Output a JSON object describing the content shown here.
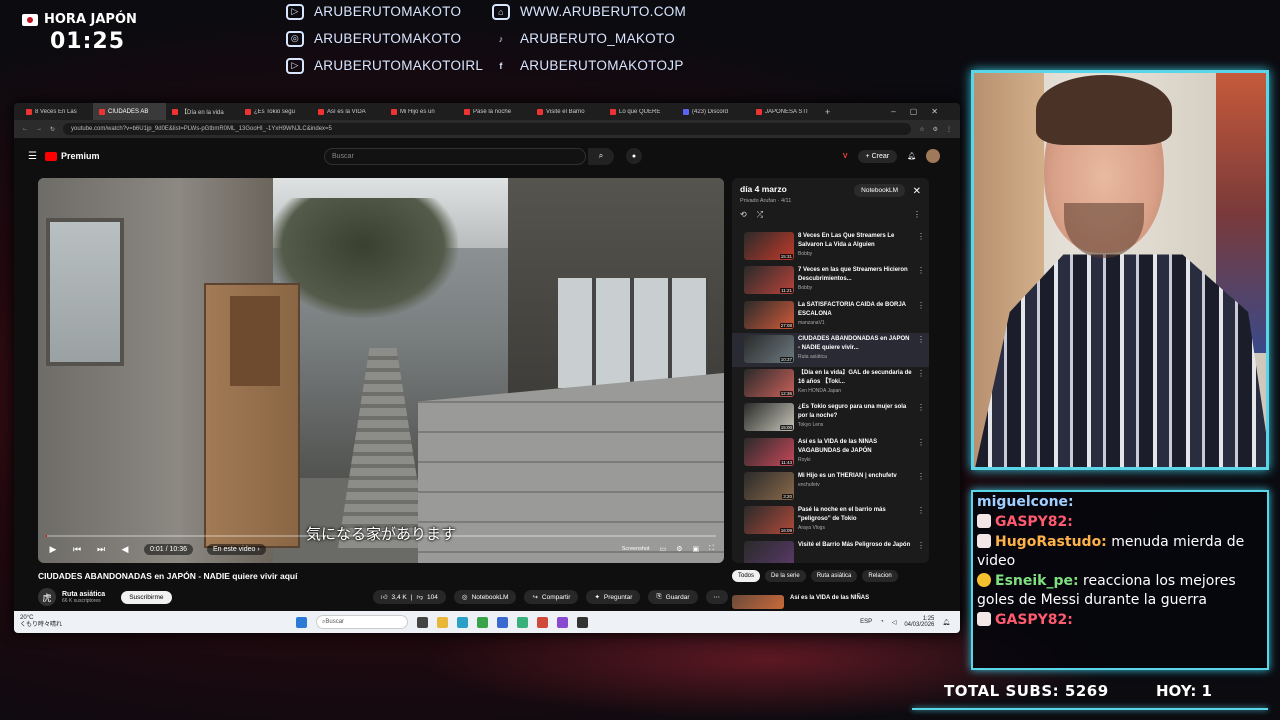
{
  "overlay": {
    "clock_label": "HORA JAPÓN",
    "clock_time": "01:25",
    "socials": [
      {
        "icon": "twitch-icon",
        "text": "ARUBERUTOMAKOTO"
      },
      {
        "icon": "web-icon",
        "text": "WWW.ARUBERUTO.COM"
      },
      {
        "icon": "instagram-icon",
        "text": "ARUBERUTOMAKOTO"
      },
      {
        "icon": "tiktok-icon",
        "text": "ARUBERUTO_MAKOTO"
      },
      {
        "icon": "twitch-icon",
        "text": "ARUBERUTOMAKOTOIRL"
      },
      {
        "icon": "facebook-icon",
        "text": "ARUBERUTOMAKOTOJP"
      }
    ],
    "accent": "#5ad6e8"
  },
  "browser": {
    "tabs": [
      "8 Veces En Las",
      "CIUDADES AB",
      "【Día en la vida",
      "¿Es Tokio segu",
      "Así es la VIDA",
      "Mi Hijo es un",
      "Pasé la noche",
      "Visité el Barrio",
      "Lo que QUERE",
      "(423) Discord",
      "JAPONESA STI"
    ],
    "url": "youtube.com/watch?v=b6U1jp_9d0E&list=PLWs-pGtbmR0ML_13GooHI_-1YxH9WNJLC&index=5"
  },
  "youtube": {
    "logo": "Premium",
    "search_placeholder": "Buscar",
    "create": "Crear",
    "video": {
      "subtitle": "気になる家があります",
      "time": "0:01 / 10:36",
      "chapter": "En este video",
      "screenshot_label": "Screenshot",
      "title": "CIUDADES ABANDONADAS en JAPÓN - NADIE quiere vivir aquí",
      "channel": "Ruta asiática",
      "subscribers": "66 K suscriptores",
      "subscribe": "Suscribirme",
      "likes": "3,4 K",
      "dislikes": "104",
      "notebook": "NotebookLM",
      "share": "Compartir",
      "ask": "Preguntar",
      "save": "Guardar",
      "progress": 0.002
    },
    "playlist": {
      "title": "día 4 marzo",
      "meta": "Privado  Arufan · 4/11",
      "notebook": "NotebookLM",
      "items": [
        {
          "title": "8 Veces En Las Que Streamers Le Salvaron La Vida a Alguien",
          "channel": "Bobby",
          "duration": "15:31"
        },
        {
          "title": "7 Veces en las que Streamers Hicieron Descubrimientos...",
          "channel": "Bobby",
          "duration": "11:21"
        },
        {
          "title": "La SATISFACTORIA CAÍDA de BORJA ESCALONA",
          "channel": "manzanaV1",
          "duration": "27:08"
        },
        {
          "title": "CIUDADES ABANDONADAS en JAPÓN - NADIE quiere vivir...",
          "channel": "Ruta asiática",
          "duration": "10:37"
        },
        {
          "title": "【Día en la vida】GAL de secundaria de 16 años 【Toki...",
          "channel": "Ken HONDA Japan",
          "duration": "12:36"
        },
        {
          "title": "¿Es Tokio seguro para una mujer sola por la noche?",
          "channel": "Tokyo Lens",
          "duration": "15:00"
        },
        {
          "title": "Así es la VIDA de las NIÑAS VAGABUNDAS de JAPÓN",
          "channel": "Royki",
          "duration": "11:43"
        },
        {
          "title": "Mi Hijo es un THERIAN | enchufetv",
          "channel": "enchufetv",
          "duration": "3:20"
        },
        {
          "title": "Pasé la noche en el barrio más \"peligroso\" de Tokio",
          "channel": "Araya Vlogs",
          "duration": "16:09"
        },
        {
          "title": "Visité el Barrio Más Peligroso de Japón",
          "channel": "",
          "duration": "15:16"
        }
      ],
      "active_index": 3
    },
    "chips": [
      "Todos",
      "De la serie",
      "Ruta asiática",
      "Relacion"
    ],
    "next_video": "Así es la VIDA de las NIÑAS"
  },
  "taskbar": {
    "weather_temp": "20°C",
    "weather_desc": "くもり時々晴れ",
    "search": "Buscar",
    "lang": "ESP",
    "time": "1:25",
    "date": "04/03/2026"
  },
  "chat": [
    {
      "user": "miguelcone:",
      "color": "#9fd0ff",
      "text": "",
      "badge": ""
    },
    {
      "user": "GASPY82:",
      "color": "#ff5a6e",
      "text": "",
      "badge": "fox"
    },
    {
      "user": "HugoRastudo:",
      "color": "#ffb347",
      "text": "menuda mierda de video",
      "badge": "fox"
    },
    {
      "user": "Esneik_pe:",
      "color": "#7ee07e",
      "text": "reacciona los mejores goles de Messi durante la guerra",
      "badge": "coin"
    },
    {
      "user": "GASPY82:",
      "color": "#ff5a6e",
      "text": "",
      "badge": "fox"
    }
  ],
  "stats": {
    "total_subs_label": "TOTAL SUBS: 5269",
    "today_label": "HOY: 1"
  }
}
